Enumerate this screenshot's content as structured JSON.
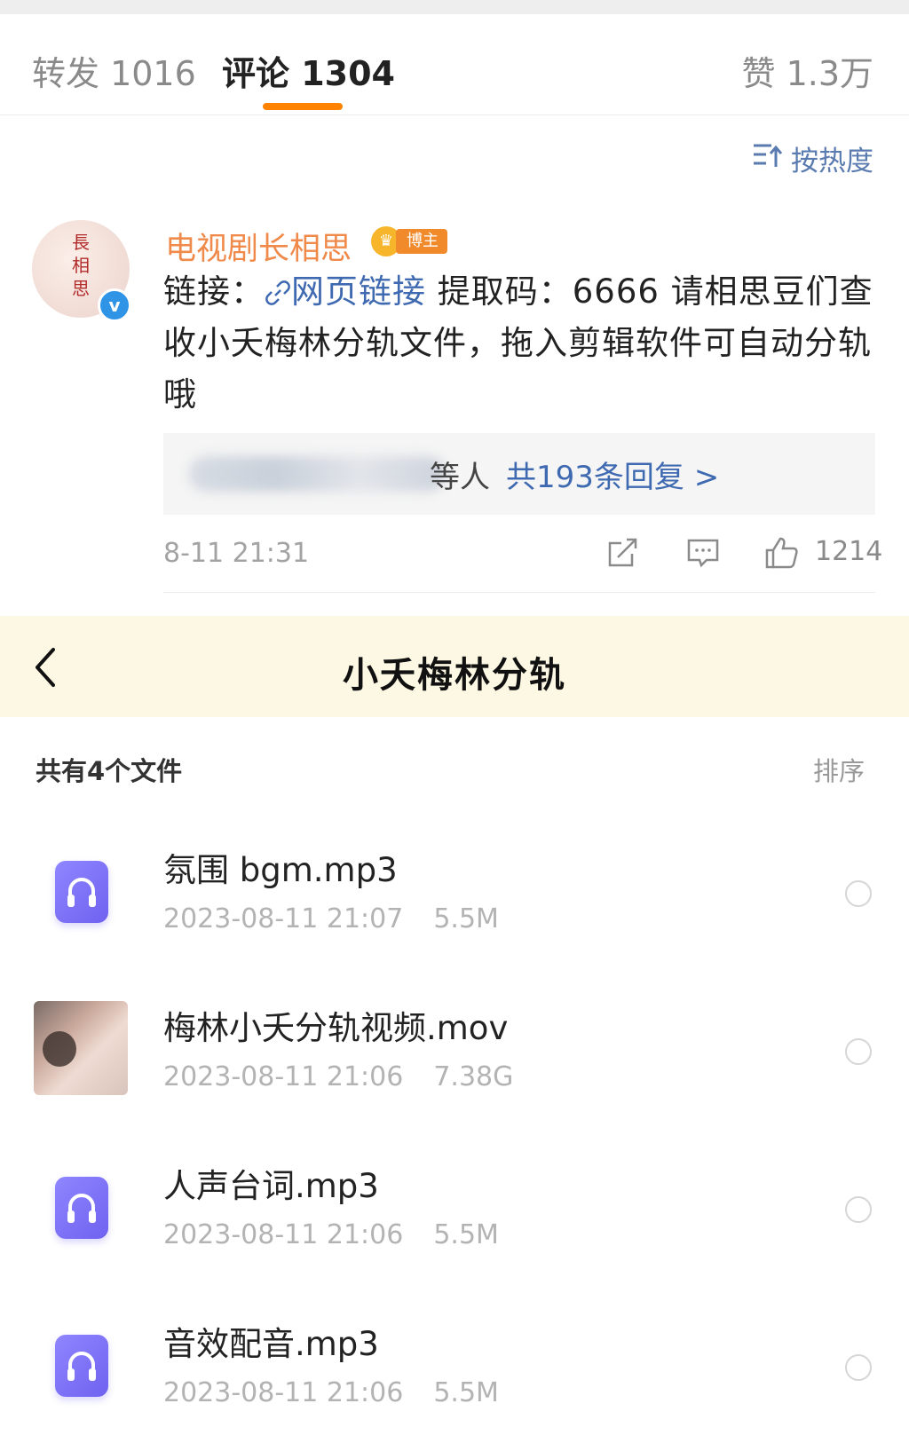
{
  "tabs": [
    {
      "label": "转发 1016"
    },
    {
      "label": "评论 1304"
    },
    {
      "label": "赞 1.3万"
    }
  ],
  "sort_label": "按热度",
  "comment": {
    "avatar_text": "長相思",
    "username": "电视剧长相思",
    "badge_label": "博主",
    "text_prefix": "链接：",
    "link_label": "网页链接",
    "text_body": " 提取码：6666 请相思豆们查收小夭梅林分轨文件，拖入剪辑软件可自动分轨哦",
    "reply_who": "等人",
    "reply_count": "共193条回复 >",
    "time": "8-11 21:31",
    "like_count": "1214"
  },
  "panel": {
    "title": "小夭梅林分轨",
    "file_count": "共有4个文件",
    "sort_label": "排序"
  },
  "files": [
    {
      "name": "氛围 bgm.mp3",
      "date": "2023-08-11 21:07",
      "size": "5.5M",
      "type": "audio"
    },
    {
      "name": "梅林小夭分轨视频.mov",
      "date": "2023-08-11 21:06",
      "size": "7.38G",
      "type": "video"
    },
    {
      "name": "人声台词.mp3",
      "date": "2023-08-11 21:06",
      "size": "5.5M",
      "type": "audio"
    },
    {
      "name": "音效配音.mp3",
      "date": "2023-08-11 21:06",
      "size": "5.5M",
      "type": "audio"
    }
  ],
  "colors": {
    "accent": "#ff8200",
    "link": "#3f6ab1",
    "username": "#f08a4b",
    "panel_header_bg": "#fdf8e3",
    "audio_icon": "#7a6ff5"
  },
  "icons": [
    "sort-icon",
    "link-icon",
    "share-icon",
    "comment-icon",
    "like-icon",
    "back-icon",
    "headphones-icon"
  ]
}
